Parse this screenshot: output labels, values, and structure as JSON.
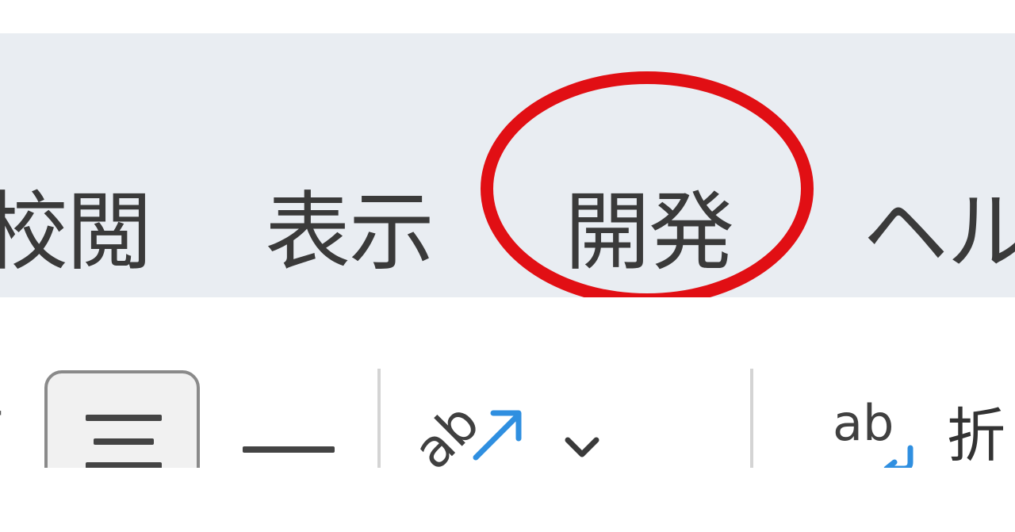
{
  "ribbon": {
    "tabs": [
      {
        "label": "校閲"
      },
      {
        "label": "表示"
      },
      {
        "label": "開発"
      },
      {
        "label": "ヘル"
      }
    ],
    "highlight_color": "#e10f14",
    "background": "#e9edf2"
  },
  "toolbar": {
    "text_direction_icon": "text-direction-icon",
    "text_direction_glyph": "ab",
    "wrap_text_glyph": "ab",
    "wrap_text_label": "折"
  },
  "colors": {
    "accent_blue": "#2f8fe0",
    "text": "#3a3a3a"
  }
}
